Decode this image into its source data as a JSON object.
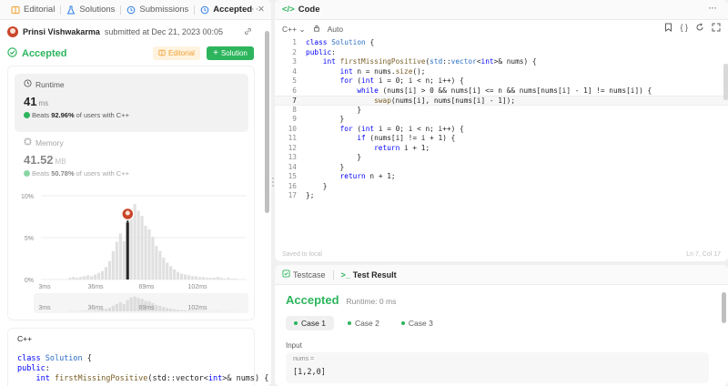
{
  "left_tabs": [
    {
      "label": "Editorial",
      "icon": "book-icon"
    },
    {
      "label": "Solutions",
      "icon": "flask-icon"
    },
    {
      "label": "Submissions",
      "icon": "history-icon"
    },
    {
      "label": "Accepted",
      "icon": "history-icon",
      "active": true
    }
  ],
  "submission": {
    "user": "Prinsi Vishwakarma",
    "submitted_text": "submitted at Dec 21, 2023 00:05",
    "status": "Accepted",
    "editorial_label": "Editorial",
    "solution_label": "Solution"
  },
  "runtime": {
    "label": "Runtime",
    "value": "41",
    "unit": "ms",
    "beats_prefix": "Beats",
    "beats_pct": "92.96%",
    "beats_suffix": "of users with C++"
  },
  "memory": {
    "label": "Memory",
    "value": "41.52",
    "unit": "MB",
    "beats_prefix": "Beats",
    "beats_pct": "50.78%",
    "beats_suffix": "of users with C++"
  },
  "chart_data": {
    "type": "bar",
    "y_ticks": [
      "10%",
      "5%",
      "0%"
    ],
    "x_ticks": [
      "3ms",
      "36ms",
      "69ms",
      "102ms"
    ],
    "ylim": [
      0,
      10
    ],
    "values": [
      0.2,
      0.3,
      0.2,
      0.3,
      0.4,
      0.5,
      0.4,
      0.6,
      0.8,
      1.0,
      1.5,
      2.2,
      3.4,
      4.5,
      5.5,
      4.6,
      6.8,
      8.5,
      9.0,
      8.2,
      7.6,
      6.4,
      6.0,
      5.1,
      4.0,
      3.4,
      2.6,
      2.0,
      1.6,
      1.2,
      0.9,
      0.7,
      0.6,
      0.5,
      0.4,
      0.4,
      0.3,
      0.3,
      0.2,
      0.2,
      0.2,
      0.3,
      0.2,
      0.1,
      0.2,
      0.1,
      0.1
    ],
    "highlight_index": 16,
    "colors": {
      "bars": "#e0e0e0",
      "highlight": "#262626"
    }
  },
  "code_card": {
    "lang": "C++",
    "lines": [
      "class Solution {",
      "public:",
      "    int firstMissingPositive(std::vector<int>& nums) {"
    ]
  },
  "code_pane": {
    "title": "Code",
    "lang": "C++",
    "auto_label": "Auto",
    "status": "Saved to local",
    "cursor": "Ln 7, Col 17",
    "current_line": 7,
    "lines": [
      "class Solution {",
      "public:",
      "    int firstMissingPositive(std::vector<int>& nums) {",
      "        int n = nums.size();",
      "        for (int i = 0; i < n; i++) {",
      "            while (nums[i] > 0 && nums[i] <= n && nums[nums[i] - 1] != nums[i]) {",
      "                swap(nums[i], nums[nums[i] - 1]);",
      "            }",
      "        }",
      "        for (int i = 0; i < n; i++) {",
      "            if (nums[i] != i + 1) {",
      "                return i + 1;",
      "            }",
      "        }",
      "        return n + 1;",
      "    }",
      "};"
    ]
  },
  "result": {
    "tab_testcase": "Testcase",
    "tab_result": "Test Result",
    "status": "Accepted",
    "runtime": "Runtime: 0 ms",
    "cases": [
      "Case 1",
      "Case 2",
      "Case 3"
    ],
    "input_label": "Input",
    "var_name": "nums =",
    "var_value": "[1,2,0]"
  },
  "colors": {
    "accent": "#2db55d",
    "orange": "#f0a030"
  }
}
